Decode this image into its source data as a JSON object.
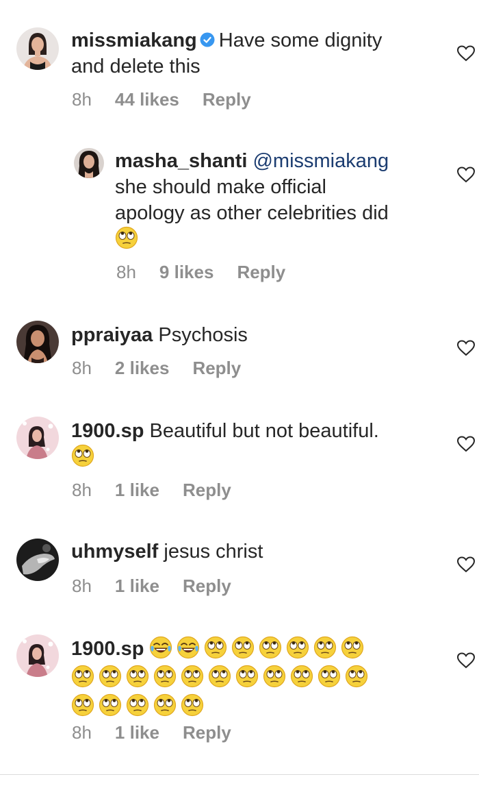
{
  "colors": {
    "text": "#262626",
    "meta": "#8e8e8e",
    "mention": "#1b3c70",
    "verified": "#3897f0",
    "divider": "#dbdbdb"
  },
  "comments": [
    {
      "username": "missmiakang",
      "verified": true,
      "text_line1": "Have some dignity",
      "text_line2": "and delete this",
      "time": "8h",
      "likes": "44 likes",
      "reply": "Reply",
      "avatar_icon": "woman-avatar",
      "like_icon": "heart-outline-icon"
    },
    {
      "username": "masha_shanti",
      "mention": "@missmiakang",
      "text_line1": "she should make official",
      "text_line2": "apology as other celebrities did",
      "emojis": [
        "face-with-rolling-eyes"
      ],
      "time": "8h",
      "likes": "9 likes",
      "reply": "Reply",
      "avatar_icon": "woman-avatar",
      "like_icon": "heart-outline-icon"
    },
    {
      "username": "ppraiyaa",
      "text_line1": "Psychosis",
      "time": "8h",
      "likes": "2 likes",
      "reply": "Reply",
      "avatar_icon": "woman-avatar",
      "like_icon": "heart-outline-icon"
    },
    {
      "username": "1900.sp",
      "text_line1": "Beautiful but not beautiful.",
      "emojis": [
        "face-with-rolling-eyes"
      ],
      "time": "8h",
      "likes": "1 like",
      "reply": "Reply",
      "avatar_icon": "pink-avatar",
      "like_icon": "heart-outline-icon"
    },
    {
      "username": "uhmyself",
      "text_line1": "jesus christ",
      "time": "8h",
      "likes": "1 like",
      "reply": "Reply",
      "avatar_icon": "dark-avatar",
      "like_icon": "heart-outline-icon"
    },
    {
      "username": "1900.sp",
      "emojis_line1": [
        "face-with-tears-of-joy",
        "face-with-tears-of-joy",
        "face-with-rolling-eyes",
        "face-with-rolling-eyes",
        "face-with-rolling-eyes",
        "face-with-rolling-eyes",
        "face-with-rolling-eyes",
        "face-with-rolling-eyes"
      ],
      "emojis_line2": [
        "face-with-rolling-eyes",
        "face-with-rolling-eyes",
        "face-with-rolling-eyes",
        "face-with-rolling-eyes",
        "face-with-rolling-eyes",
        "face-with-rolling-eyes",
        "face-with-rolling-eyes",
        "face-with-rolling-eyes",
        "face-with-rolling-eyes",
        "face-with-rolling-eyes",
        "face-with-rolling-eyes"
      ],
      "emojis_line3": [
        "face-with-rolling-eyes",
        "face-with-rolling-eyes",
        "face-with-rolling-eyes",
        "face-with-rolling-eyes",
        "face-with-rolling-eyes"
      ],
      "time": "8h",
      "likes": "1 like",
      "reply": "Reply",
      "avatar_icon": "pink-avatar",
      "like_icon": "heart-outline-icon"
    }
  ]
}
